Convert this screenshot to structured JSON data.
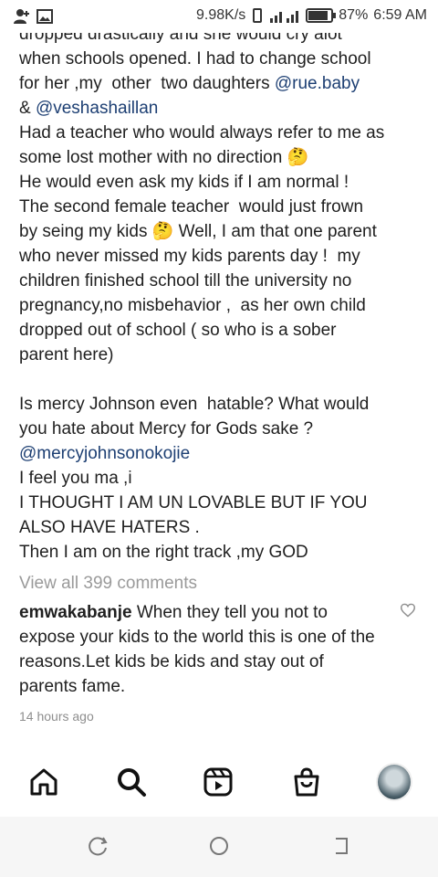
{
  "status_bar": {
    "speed": "9.98K/s",
    "battery": "87%",
    "time": "6:59 AM"
  },
  "caption": {
    "lines": [
      "dropped drastically and she would cry alot",
      "when schools opened. I had to change school",
      "for her ,my  other  two daughters ",
      "& ",
      "Had a teacher who would always refer to me as",
      "some lost mother with no direction 🤔",
      "He would even ask my kids if I am normal !",
      "The second female teacher  would just frown",
      "by seing my kids 🤔 Well, I am that one parent",
      "who never missed my kids parents day !  my",
      "children finished school till the university no",
      "pregnancy,no misbehavior ,  as her own child",
      "dropped out of school ( so who is a sober",
      "parent here)",
      "Is mercy Johnson even  hatable? What would",
      "you hate about Mercy for Gods sake ?",
      "I feel you ma ,i",
      "I THOUGHT I AM UN LOVABLE BUT IF YOU",
      "ALSO HAVE HATERS .",
      "Then I am on the right track ,my GOD"
    ],
    "mentions": {
      "rue": "@rue.baby",
      "vesha": "@veshashaillan",
      "mercy": "@mercyjohnsonokojie"
    }
  },
  "view_all_comments": "View all 399 comments",
  "comment": {
    "username": "emwakabanje",
    "text": " When they tell you not to expose your kids to the world this is one of the reasons.Let kids be kids and stay out of parents fame."
  },
  "timestamp": "14 hours ago",
  "nav": {
    "icons": [
      "home-icon",
      "search-icon",
      "reels-icon",
      "shop-icon",
      "profile-avatar"
    ]
  },
  "system_nav": {
    "icons": [
      "recent-apps-icon",
      "home-circle-icon",
      "back-icon"
    ]
  }
}
